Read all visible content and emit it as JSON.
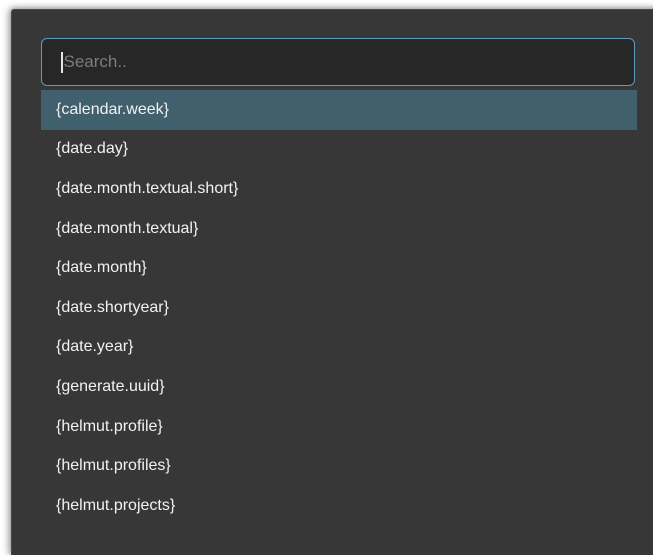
{
  "search": {
    "placeholder": "Search..",
    "value": ""
  },
  "colors": {
    "panel_background": "#373737",
    "input_background": "#272727",
    "input_border": "#5d9cb8",
    "selected_row": "#41606e",
    "text": "#f2f2f2"
  },
  "list": {
    "selected_index": 0,
    "items": [
      {
        "label": "{calendar.week}"
      },
      {
        "label": "{date.day}"
      },
      {
        "label": "{date.month.textual.short}"
      },
      {
        "label": "{date.month.textual}"
      },
      {
        "label": "{date.month}"
      },
      {
        "label": "{date.shortyear}"
      },
      {
        "label": "{date.year}"
      },
      {
        "label": "{generate.uuid}"
      },
      {
        "label": "{helmut.profile}"
      },
      {
        "label": "{helmut.profiles}"
      },
      {
        "label": "{helmut.projects}"
      }
    ]
  }
}
